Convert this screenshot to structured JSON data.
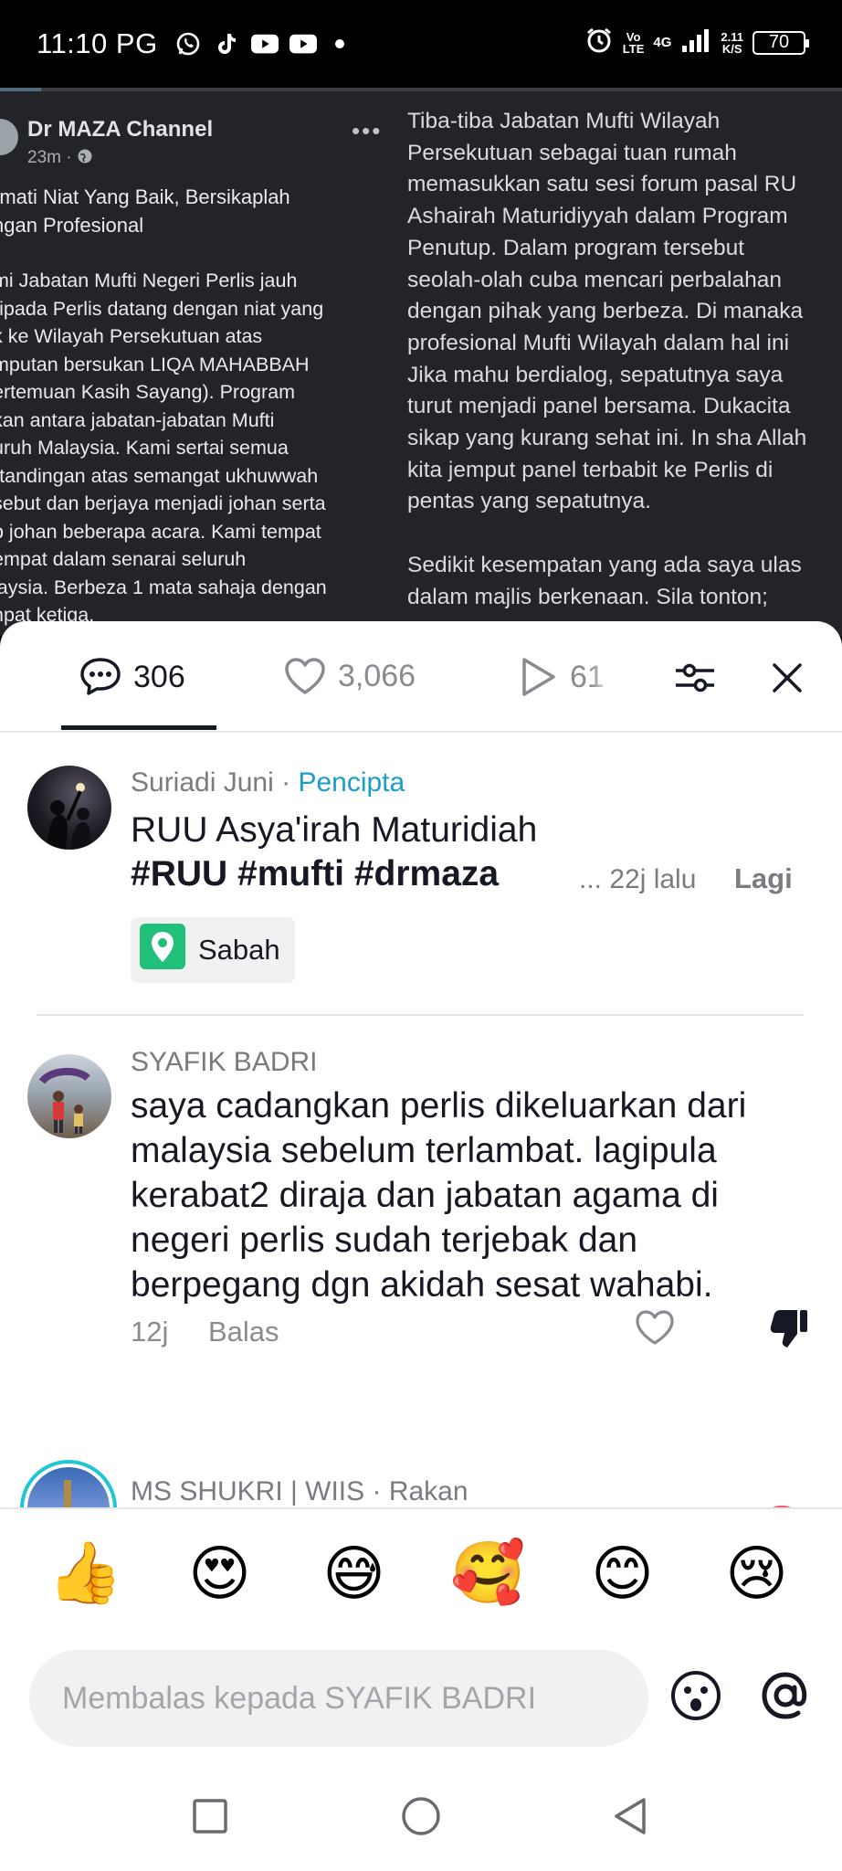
{
  "status_bar": {
    "time": "11:10 PG",
    "network_top": "Vo",
    "network_bottom": "LTE",
    "signal": "4G",
    "speed_top": "2.11",
    "speed_bottom": "K/S",
    "battery": "70",
    "app_icons": [
      "whatsapp-icon",
      "tiktok-icon",
      "youtube-icon",
      "youtube-icon"
    ]
  },
  "video": {
    "post_name": "Dr MAZA Channel",
    "post_time": "23m ·",
    "post_title": "rmati Niat Yang Baik, Bersikaplah\nngan Profesional",
    "post_body": "mi Jabatan Mufti Negeri Perlis jauh\nripada Perlis datang dengan niat yang\nk ke Wilayah Persekutuan atas\nmputan bersukan LIQA MAHABBAH\nertemuan Kasih Sayang). Program\nkan antara jabatan-jabatan Mufti\nuruh Malaysia. Kami sertai semua\nrtandingan atas semangat ukhuwwah\nsebut dan berjaya menjadi johan serta\nb johan beberapa acara. Kami tempat\nempat dalam senarai seluruh\nlaysia. Berbeza 1 mata sahaja dengan\nnpat ketiga.",
    "right_text": "Tiba-tiba Jabatan Mufti Wilayah\nPersekutuan sebagai tuan rumah\nmemasukkan satu sesi forum pasal RU\nAshairah Maturidiyyah dalam Program\nPenutup. Dalam program tersebut\nseolah-olah cuba mencari perbalahan\ndengan pihak yang berbeza. Di manaka\nprofesional Mufti Wilayah dalam hal ini\nJika mahu berdialog, sepatutnya saya\nturut menjadi panel bersama. Dukacita\nsikap yang kurang sehat ini. In sha Allah\nkita jemput panel terbabit ke Perlis di\npentas yang sepatutnya.\n\nSedikit kesempatan yang ada saya ulas\ndalam majlis berkenaan. Sila tonton;"
  },
  "tabs": {
    "comments_count": "306",
    "likes_count": "3,066",
    "plays_count": "61"
  },
  "caption": {
    "author": "Suriadi Juni",
    "separator": " · ",
    "role": "Pencipta",
    "line1": "RUU Asya'irah Maturidiah",
    "line2": "#RUU #mufti #drmaza",
    "time": "... 22j lalu",
    "more": "Lagi",
    "location": "Sabah"
  },
  "comments": [
    {
      "author": "SYAFIK BADRI",
      "text": "saya cadangkan perlis dikeluarkan dari malaysia sebelum terlambat. lagipula kerabat2 diraja dan jabatan agama di negeri perlis sudah terjebak dan berpegang dgn akidah sesat wahabi.",
      "time": "12j",
      "reply": "Balas"
    },
    {
      "author": "MS SHUKRI | WIIS",
      "tag": " · Rakan"
    }
  ],
  "emojis": [
    "👍",
    "😍",
    "😅",
    "🥰",
    "😊",
    "😢"
  ],
  "reply_input": {
    "placeholder": "Membalas kepada SYAFIK BADRI"
  },
  "colors": {
    "creator_blue": "#1b9ec6",
    "location_green": "#20c07a",
    "text_primary": "#161823"
  }
}
